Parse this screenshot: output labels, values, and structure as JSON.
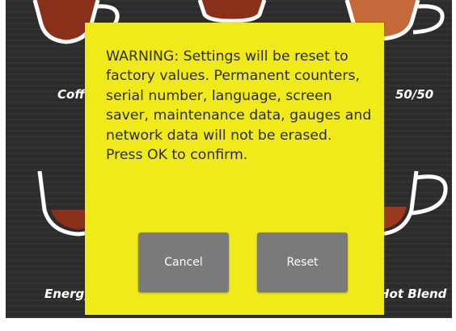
{
  "tiles": {
    "top_left": "Coffee",
    "top_right": "50/50",
    "bottom_left": "Energy",
    "bottom_right": "Hot Blend"
  },
  "dialog": {
    "message": "WARNING: Settings will be reset to factory values. Permanent counters, serial number, language, screen saver, maintenance data, gauges and network data will not be erased. Press OK to confirm.",
    "cancel_label": "Cancel",
    "reset_label": "Reset",
    "background_color": "#f0ea1a",
    "button_color": "#7a7a7a"
  }
}
